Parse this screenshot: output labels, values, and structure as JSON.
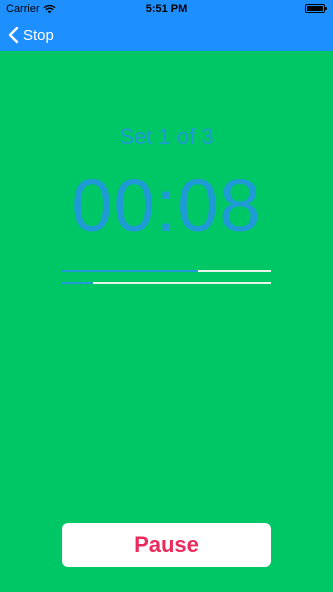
{
  "status_bar": {
    "carrier": "Carrier",
    "time": "5:51 PM"
  },
  "nav": {
    "back_label": "Stop"
  },
  "workout": {
    "set_label": "Set 1 of 3",
    "timer": "00:08",
    "set_progress": 0.65,
    "time_progress": 0.15
  },
  "actions": {
    "pause_label": "Pause"
  },
  "colors": {
    "nav_background": "#1e8fff",
    "screen_background": "#00c765",
    "accent_text": "#1e9ad6",
    "pause_text": "#ec2b5c"
  }
}
